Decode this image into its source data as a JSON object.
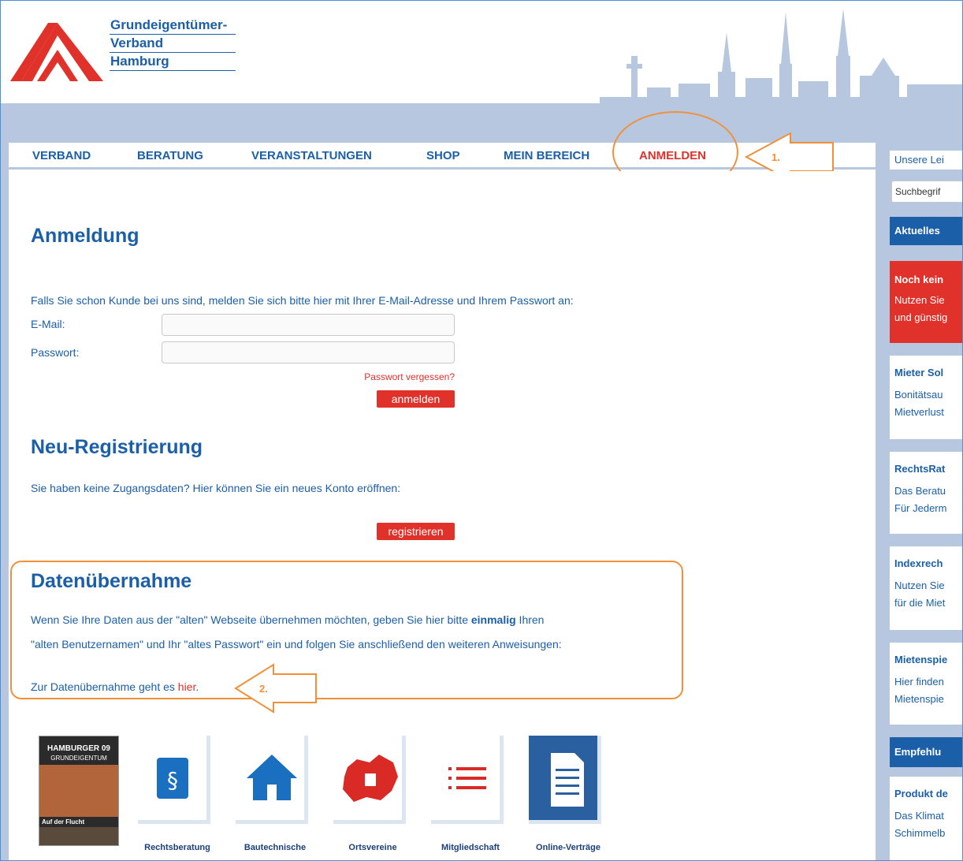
{
  "logo": {
    "line1": "Grundeigentümer-",
    "line2": "Verband",
    "line3": "Hamburg"
  },
  "nav": {
    "items": [
      "VERBAND",
      "BERATUNG",
      "VERANSTALTUNGEN",
      "SHOP",
      "MEIN BEREICH",
      "ANMELDEN"
    ],
    "active": "ANMELDEN"
  },
  "annotations": {
    "step1": "1.",
    "step2": "2."
  },
  "login": {
    "heading": "Anmeldung",
    "intro": "Falls Sie schon Kunde bei uns sind, melden Sie sich bitte hier mit Ihrer E-Mail-Adresse und Ihrem Passwort an:",
    "email_label": "E-Mail:",
    "password_label": "Passwort:",
    "email_value": "",
    "password_value": "",
    "forgot_label": "Passwort vergessen?",
    "submit_label": "anmelden"
  },
  "register": {
    "heading": "Neu-Registrierung",
    "intro": "Sie haben keine Zugangsdaten? Hier können Sie ein neues Konto eröffnen:",
    "submit_label": "registrieren"
  },
  "migration": {
    "heading": "Datenübernahme",
    "line1_pre": "Wenn Sie Ihre Daten aus der \"alten\" Webseite übernehmen möchten, geben Sie hier bitte ",
    "line1_bold": "einmalig",
    "line1_post": " Ihren",
    "line2": "\"alten Benutzernamen\" und Ihr \"altes Passwort\" ein und folgen Sie anschließend den weiteren Anweisungen:",
    "link_pre": "Zur Datenübernahme geht es ",
    "link_label": "hier",
    "link_post": "."
  },
  "magazine": {
    "title": "HAMBURGER 09",
    "subtitle": "GRUNDEIGENTUM",
    "headline": "Auf der Flucht"
  },
  "tiles": [
    "Rechtsberatung",
    "Bautechnische",
    "Ortsvereine",
    "Mitgliedschaft",
    "Online-Verträge"
  ],
  "sidebar": {
    "top_link": "Unsere Lei",
    "search_placeholder": "Suchbegrif",
    "aktuelles": "Aktuelles",
    "noch_kein": "Noch kein",
    "noch_line1": "Nutzen Sie",
    "noch_line2": "und günstig",
    "mieter_head": "Mieter Sol",
    "mieter_line1": "Bonitätsau",
    "mieter_line2": "Mietverlust",
    "rechts_head": "RechtsRat",
    "rechts_line1": "Das Beratu",
    "rechts_line2": "Für Jederm",
    "index_head": "Indexrech",
    "index_line1": "Nutzen Sie",
    "index_line2": "für die Miet",
    "mieten_head": "Mietenspie",
    "mieten_line1": "Hier finden",
    "mieten_line2": "Mietenspie",
    "empfehlung": "Empfehlu",
    "produkt_head": "Produkt de",
    "produkt_line1": "Das Klimat",
    "produkt_line2": "Schimmelb"
  },
  "colors": {
    "brand_blue": "#1b5fa8",
    "accent_red": "#e0312a",
    "annotation_orange": "#f0913a",
    "sky": "#b7c7e0"
  }
}
